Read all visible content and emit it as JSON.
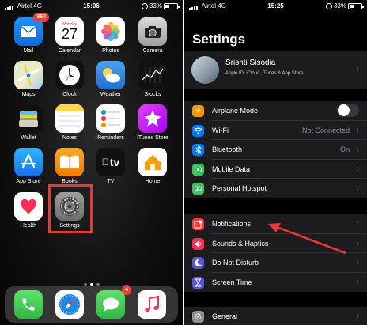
{
  "home": {
    "status": {
      "carrier": "Airtel",
      "network": "4G",
      "time": "15:06",
      "battery": "33%"
    },
    "apps": [
      {
        "label": "Mail",
        "badge": "964"
      },
      {
        "label": "Calendar",
        "day": "Monday",
        "date": "27"
      },
      {
        "label": "Photos"
      },
      {
        "label": "Camera"
      },
      {
        "label": "Maps"
      },
      {
        "label": "Clock"
      },
      {
        "label": "Weather"
      },
      {
        "label": "Stocks"
      },
      {
        "label": "Wallet"
      },
      {
        "label": "Notes"
      },
      {
        "label": "Reminders"
      },
      {
        "label": "iTunes Store"
      },
      {
        "label": "App Store"
      },
      {
        "label": "Books"
      },
      {
        "label": "TV",
        "glyph": "tv"
      },
      {
        "label": "Home"
      },
      {
        "label": "Health"
      },
      {
        "label": "Settings"
      }
    ],
    "dock": [
      {
        "name": "Phone"
      },
      {
        "name": "Safari"
      },
      {
        "name": "Messages",
        "badge": "4"
      },
      {
        "name": "Music"
      }
    ],
    "page_dots": 3,
    "active_dot": 1
  },
  "settings": {
    "status": {
      "carrier": "Airtel",
      "network": "4G",
      "time": "15:25",
      "battery": "33%"
    },
    "title": "Settings",
    "profile": {
      "name": "Srishti Sisodia",
      "subtitle": "Apple ID, iCloud, iTunes & App Store"
    },
    "group1": [
      {
        "label": "Airplane Mode",
        "icon": "airplane-icon",
        "color": "#ff9500",
        "toggle": false
      },
      {
        "label": "Wi-Fi",
        "value": "Not Connected",
        "icon": "wifi-icon",
        "color": "#007aff"
      },
      {
        "label": "Bluetooth",
        "value": "On",
        "icon": "bluetooth-icon",
        "color": "#007aff"
      },
      {
        "label": "Mobile Data",
        "icon": "mobile-data-icon",
        "color": "#34c759"
      },
      {
        "label": "Personal Hotspot",
        "icon": "hotspot-icon",
        "color": "#34c759"
      }
    ],
    "group2": [
      {
        "label": "Notifications",
        "icon": "notifications-icon",
        "color": "#ff3b30"
      },
      {
        "label": "Sounds & Haptics",
        "icon": "sounds-icon",
        "color": "#ff2d55"
      },
      {
        "label": "Do Not Disturb",
        "icon": "moon-icon",
        "color": "#5856d6"
      },
      {
        "label": "Screen Time",
        "icon": "hourglass-icon",
        "color": "#5856d6"
      }
    ],
    "group3": [
      {
        "label": "General",
        "icon": "gear-icon",
        "color": "#8e8e93"
      }
    ]
  },
  "colors": {
    "highlight": "#e53935",
    "arrow": "#e53935"
  }
}
